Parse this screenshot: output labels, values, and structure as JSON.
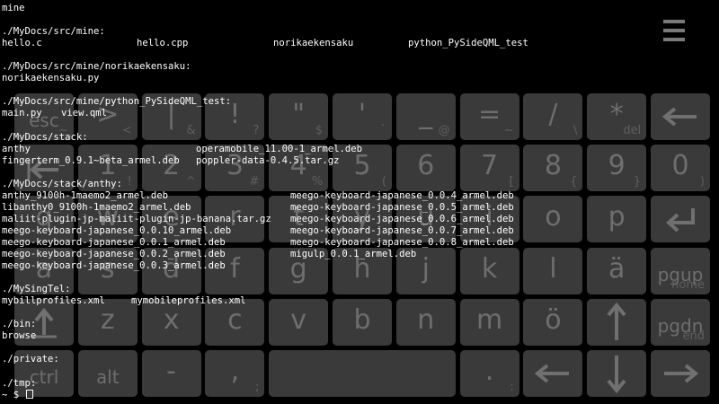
{
  "terminal": {
    "lines": [
      [
        "mine"
      ],
      [
        ""
      ],
      [
        "./MyDocs/src/mine:"
      ],
      [
        "hello.c",
        "hello.cpp",
        "norikaekensaku",
        "python_PySideQML_test"
      ],
      [
        ""
      ],
      [
        "./MyDocs/src/mine/norikaekensaku:"
      ],
      [
        "norikaekensaku.py"
      ],
      [
        ""
      ],
      [
        "./MyDocs/src/mine/python_PySideQML_test:"
      ],
      [
        "main.py",
        "view.qml"
      ],
      [
        ""
      ],
      [
        "./MyDocs/stack:"
      ],
      [
        "anthy",
        "operamobile_11.00-1_armel.deb"
      ],
      [
        "fingerterm_0.9.1~beta_armel.deb",
        "poppler-data-0.4.5.tar.gz"
      ],
      [
        ""
      ],
      [
        "./MyDocs/stack/anthy:"
      ],
      [
        "anthy_9100h-1maemo2_armel.deb",
        "meego-keyboard-japanese_0.0.4_armel.deb"
      ],
      [
        "libanthy0_9100h-1maemo2_armel.deb",
        "meego-keyboard-japanese_0.0.5_armel.deb"
      ],
      [
        "maliit-plugin-jp-maliit-plugin-jp-banana.tar.gz",
        "meego-keyboard-japanese_0.0.6_armel.deb"
      ],
      [
        "meego-keyboard-japanese_0.0.10_armel.deb",
        "meego-keyboard-japanese_0.0.7_armel.deb"
      ],
      [
        "meego-keyboard-japanese_0.0.1_armel.deb",
        "meego-keyboard-japanese_0.0.8_armel.deb"
      ],
      [
        "meego-keyboard-japanese_0.0.2_armel.deb",
        "migulp_0.0.1_armel.deb"
      ],
      [
        "meego-keyboard-japanese_0.0.3_armel.deb"
      ],
      [
        ""
      ],
      [
        "./MySingTel:"
      ],
      [
        "mybillprofiles.xml",
        "mymobileprofiles.xml"
      ],
      [
        ""
      ],
      [
        "./bin:"
      ],
      [
        "browse"
      ],
      [
        ""
      ],
      [
        "./private:"
      ],
      [
        ""
      ],
      [
        "./tmp:"
      ]
    ],
    "prompt": "~ $ "
  },
  "keyboard": {
    "rows": [
      [
        {
          "main": "esc",
          "alt": "~",
          "kind": "small"
        },
        {
          "main": ">",
          "alt": "<"
        },
        {
          "main": "|",
          "alt": "&"
        },
        {
          "main": "!",
          "alt": "?"
        },
        {
          "main": "\"",
          "alt": "$"
        },
        {
          "main": "'",
          "alt": "`"
        },
        {
          "main": "_",
          "alt": "@"
        },
        {
          "main": "=",
          "alt": "~"
        },
        {
          "main": "/",
          "alt": "\\"
        },
        {
          "main": "*",
          "alt": "del"
        },
        {
          "main": "",
          "alt": "",
          "icon": "backspace-arrow-icon"
        }
      ],
      [
        {
          "main": "",
          "alt": "",
          "icon": "tab-arrow-icon"
        },
        {
          "main": "1",
          "alt": "!"
        },
        {
          "main": "2",
          "alt": "^"
        },
        {
          "main": "3",
          "alt": "#"
        },
        {
          "main": "4",
          "alt": "%"
        },
        {
          "main": "5",
          "alt": "("
        },
        {
          "main": "6",
          "alt": ""
        },
        {
          "main": "7",
          "alt": "["
        },
        {
          "main": "8",
          "alt": "{"
        },
        {
          "main": "9",
          "alt": "}"
        },
        {
          "main": "0",
          "alt": ")"
        }
      ],
      [
        {
          "main": "q",
          "alt": ""
        },
        {
          "main": "w",
          "alt": ""
        },
        {
          "main": "e",
          "alt": ""
        },
        {
          "main": "r",
          "alt": ""
        },
        {
          "main": "t",
          "alt": ""
        },
        {
          "main": "y",
          "alt": ""
        },
        {
          "main": "u",
          "alt": ""
        },
        {
          "main": "i",
          "alt": ""
        },
        {
          "main": "o",
          "alt": ""
        },
        {
          "main": "p",
          "alt": ""
        },
        {
          "main": "",
          "alt": "",
          "icon": "enter-arrow-icon"
        }
      ],
      [
        {
          "main": "a",
          "alt": ""
        },
        {
          "main": "s",
          "alt": ""
        },
        {
          "main": "d",
          "alt": ""
        },
        {
          "main": "f",
          "alt": ""
        },
        {
          "main": "g",
          "alt": ""
        },
        {
          "main": "h",
          "alt": ""
        },
        {
          "main": "j",
          "alt": ""
        },
        {
          "main": "k",
          "alt": ""
        },
        {
          "main": "l",
          "alt": ""
        },
        {
          "main": "ä",
          "alt": ""
        },
        {
          "main": "pgup",
          "alt": "home",
          "kind": "small"
        }
      ],
      [
        {
          "main": "",
          "alt": "",
          "icon": "shift-arrow-icon"
        },
        {
          "main": "z",
          "alt": ""
        },
        {
          "main": "x",
          "alt": ""
        },
        {
          "main": "c",
          "alt": ""
        },
        {
          "main": "v",
          "alt": ""
        },
        {
          "main": "b",
          "alt": ""
        },
        {
          "main": "n",
          "alt": ""
        },
        {
          "main": "m",
          "alt": ""
        },
        {
          "main": "ö",
          "alt": ""
        },
        {
          "main": "",
          "alt": "",
          "icon": "arrow-up-icon"
        },
        {
          "main": "pgdn",
          "alt": "end",
          "kind": "small"
        }
      ],
      [
        {
          "main": "ctrl",
          "alt": "",
          "kind": "small"
        },
        {
          "main": "alt",
          "alt": "",
          "kind": "small"
        },
        {
          "main": "-",
          "alt": ""
        },
        {
          "main": ",",
          "alt": ";"
        },
        {
          "main": "",
          "alt": "",
          "kind": "space"
        },
        {
          "main": ".",
          "alt": ":"
        },
        {
          "main": "",
          "alt": "",
          "icon": "arrow-left-icon"
        },
        {
          "main": "",
          "alt": "",
          "icon": "arrow-down-icon"
        },
        {
          "main": "",
          "alt": "",
          "icon": "arrow-right-icon"
        }
      ]
    ]
  },
  "menu_icon": "menu-hamburger-icon"
}
